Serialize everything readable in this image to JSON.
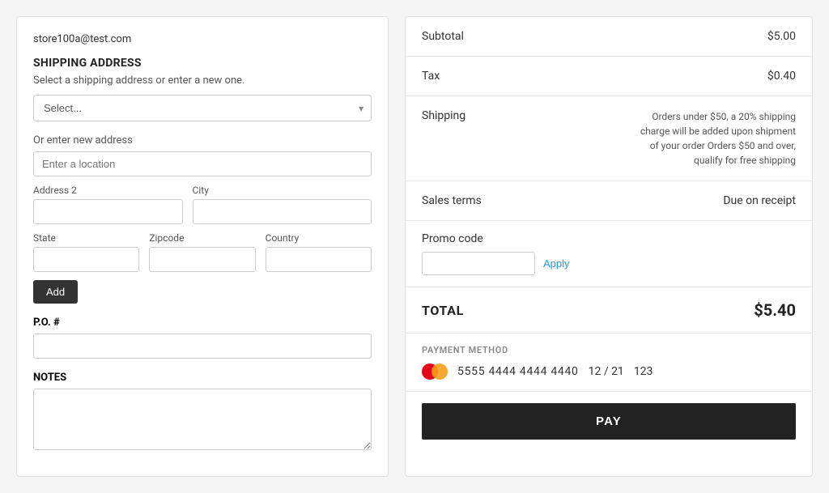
{
  "left": {
    "user_email": "store100a@test.com",
    "shipping_title": "SHIPPING ADDRESS",
    "shipping_subtitle": "Select a shipping address or enter a new one.",
    "select_placeholder": "Select...",
    "or_text": "Or enter new address",
    "location_placeholder": "Enter a location",
    "address2_label": "Address 2",
    "city_label": "City",
    "state_label": "State",
    "zipcode_label": "Zipcode",
    "country_label": "Country",
    "add_button": "Add",
    "po_label": "P.O. #",
    "notes_label": "NOTES"
  },
  "right": {
    "subtotal_label": "Subtotal",
    "subtotal_value": "$5.00",
    "tax_label": "Tax",
    "tax_value": "$0.40",
    "shipping_label": "Shipping",
    "shipping_info": "Orders under $50, a 20% shipping charge will be added upon shipment of your order Orders $50 and over, qualify for free shipping",
    "sales_terms_label": "Sales terms",
    "sales_terms_value": "Due on receipt",
    "promo_label": "Promo code",
    "promo_placeholder": "",
    "apply_label": "Apply",
    "total_label": "TOTAL",
    "total_value": "$5.40",
    "payment_label": "PAYMENT METHOD",
    "card_number": "5555 4444 4444 4440",
    "card_expiry": "12 / 21",
    "card_cvv": "123",
    "pay_button": "PAY"
  }
}
